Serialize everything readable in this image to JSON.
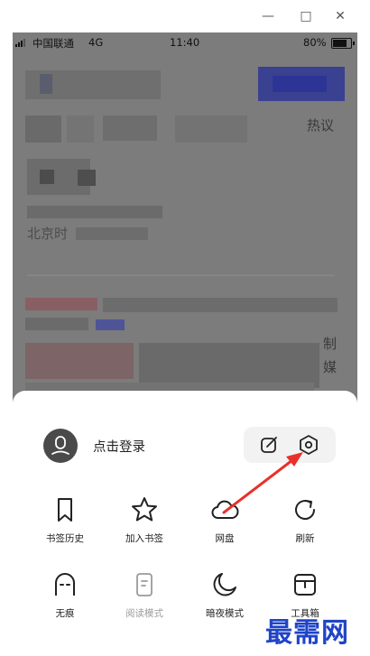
{
  "window_controls": {
    "minimize": "—",
    "maximize": "□",
    "close": "✕"
  },
  "status_bar": {
    "carrier": "中国联通",
    "network": "4G",
    "time": "11:40",
    "battery": "80%"
  },
  "background_fragments": [
    "热议",
    "北京时",
    "制",
    "媒"
  ],
  "sheet": {
    "login_label": "点击登录",
    "icons": {
      "avatar": "user-avatar-icon",
      "edit": "edit-icon",
      "settings": "settings-hexagon-icon"
    },
    "grid": [
      {
        "label": "书签历史",
        "icon": "bookmark-icon",
        "enabled": true
      },
      {
        "label": "加入书签",
        "icon": "star-icon",
        "enabled": true
      },
      {
        "label": "网盘",
        "icon": "cloud-icon",
        "enabled": true
      },
      {
        "label": "刷新",
        "icon": "refresh-icon",
        "enabled": true
      },
      {
        "label": "无痕",
        "icon": "incognito-icon",
        "enabled": true
      },
      {
        "label": "阅读模式",
        "icon": "reader-icon",
        "enabled": false
      },
      {
        "label": "暗夜模式",
        "icon": "moon-icon",
        "enabled": true
      },
      {
        "label": "工具箱",
        "icon": "toolbox-icon",
        "enabled": true
      }
    ]
  },
  "annotation": {
    "arrow_color": "#e8312b"
  },
  "watermark": "最需网"
}
